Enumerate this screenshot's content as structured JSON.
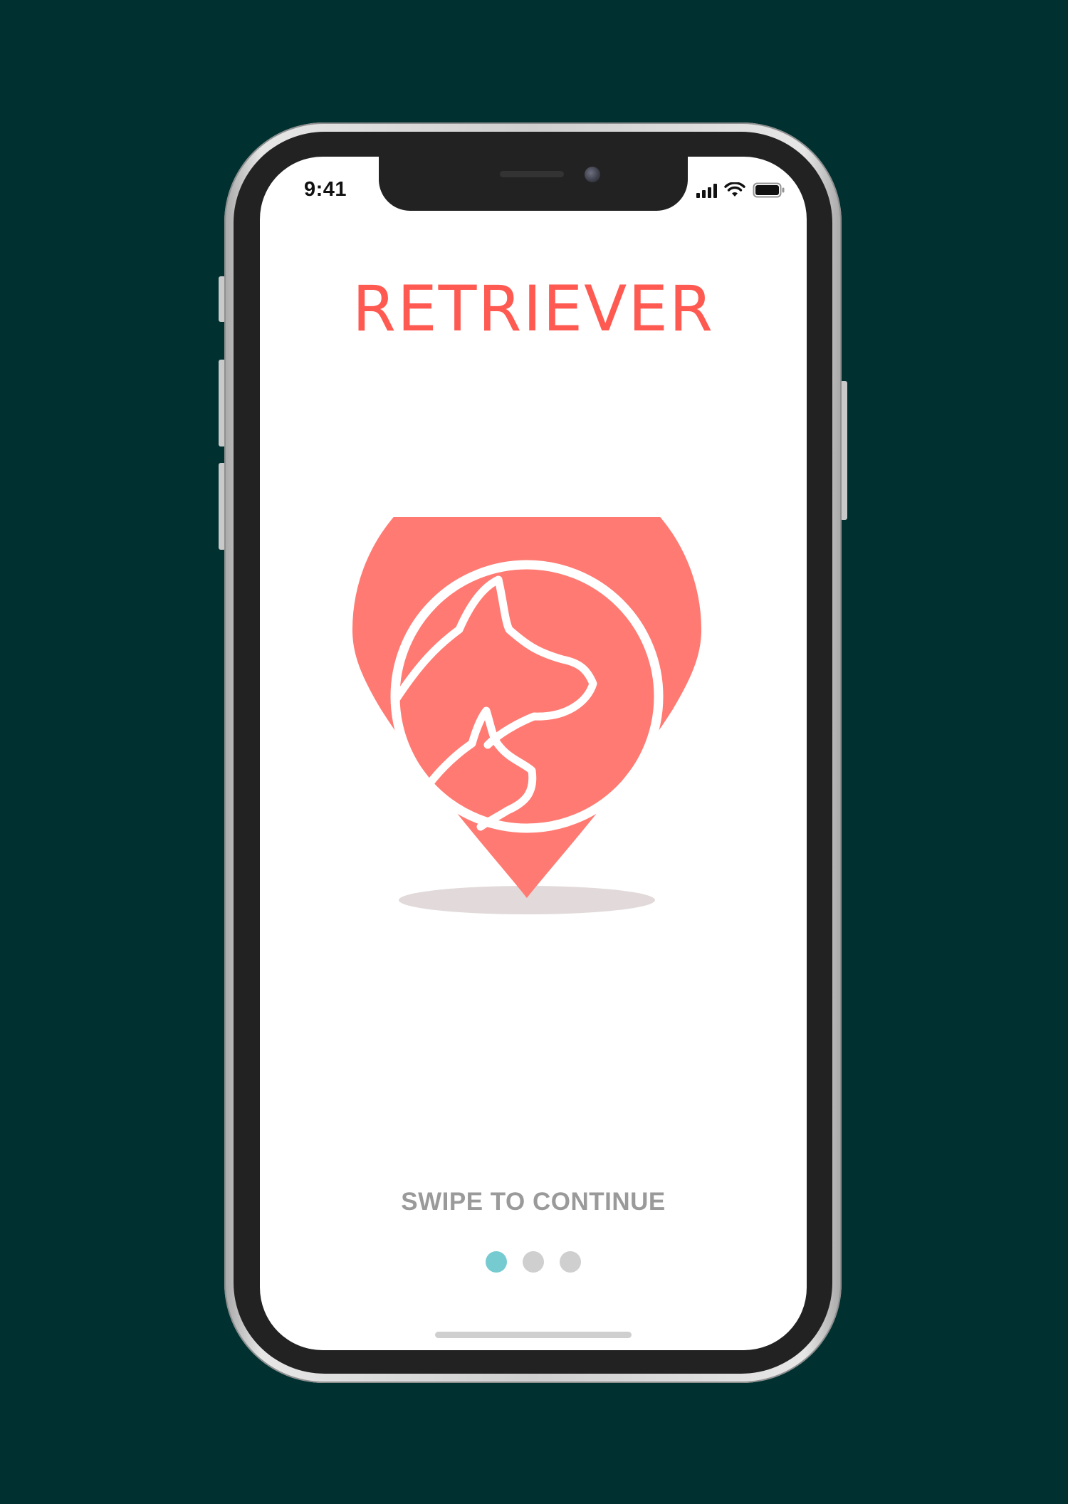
{
  "status_bar": {
    "time": "9:41",
    "icons": [
      "cellular-signal-icon",
      "wifi-icon",
      "battery-icon"
    ]
  },
  "brand": {
    "name": "RETRIEVER",
    "color": "#ff5a52"
  },
  "illustration": {
    "icon": "pet-location-pin-icon",
    "color": "#ff7a72"
  },
  "onboarding": {
    "hint": "SWIPE TO CONTINUE",
    "page_count": 3,
    "current_page": 1,
    "active_color": "#76cbd1",
    "inactive_color": "#cfcfcf"
  },
  "colors": {
    "background": "#013030",
    "screen": "#ffffff"
  }
}
